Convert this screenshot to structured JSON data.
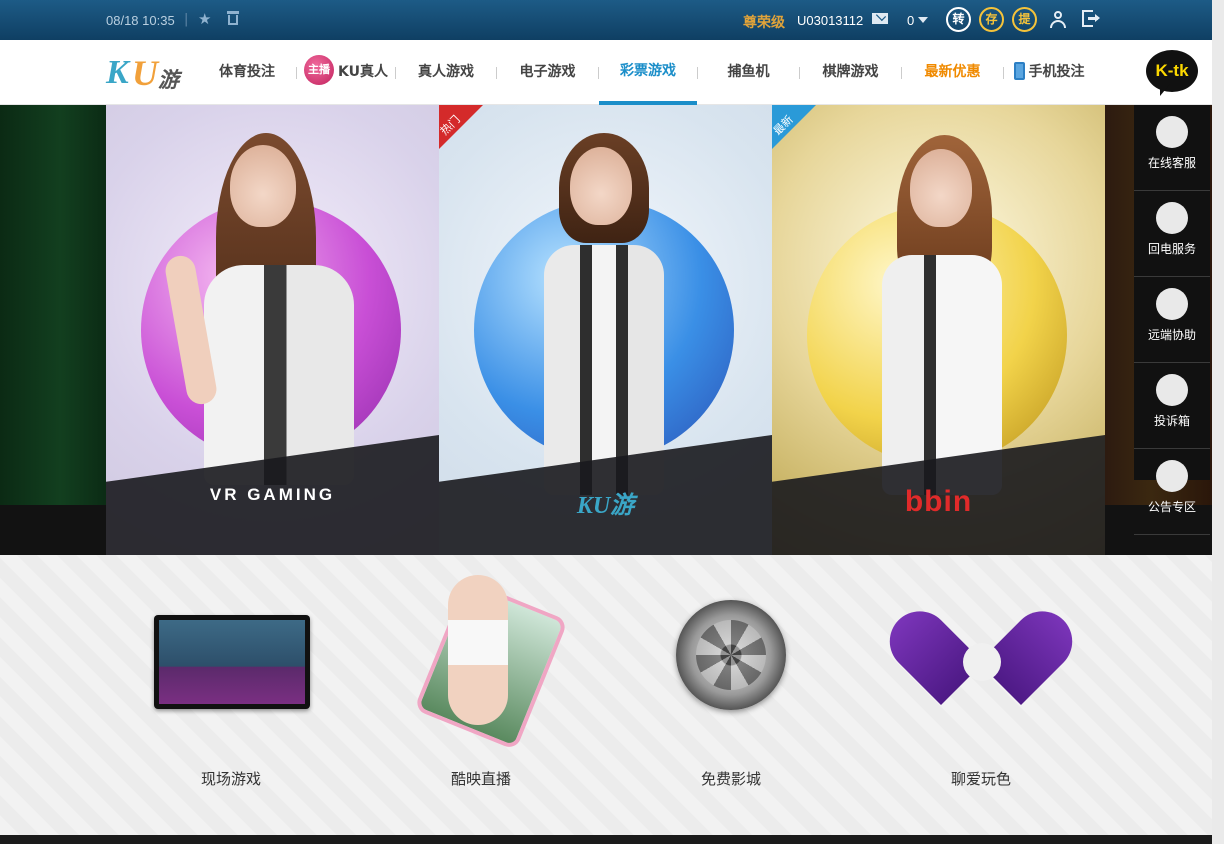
{
  "topbar": {
    "datetime": "08/18 10:35",
    "separator": "|",
    "rank": "尊荣级",
    "user_id": "U03013112",
    "balance": "0",
    "btn_transfer": "转",
    "btn_deposit": "存",
    "btn_withdraw": "提"
  },
  "nav": {
    "items": [
      {
        "label": "体育投注"
      },
      {
        "badge": "主播",
        "label": "KU真人"
      },
      {
        "label": "真人游戏"
      },
      {
        "label": "电子游戏"
      },
      {
        "label": "彩票游戏"
      },
      {
        "label": "捕鱼机"
      },
      {
        "label": "棋牌游戏"
      },
      {
        "label": "最新优惠"
      },
      {
        "label": "手机投注"
      }
    ],
    "active_index": 4,
    "promo_index": 7
  },
  "logo": {
    "k": "K",
    "u": "U",
    "you": "游"
  },
  "ktk": "K-tk",
  "hero": {
    "panels": [
      {
        "brand": "VR GAMING",
        "ribbon": "",
        "theme": "purple"
      },
      {
        "brand": "KU游",
        "ribbon": "热门",
        "theme": "blue"
      },
      {
        "brand": "bbin",
        "ribbon": "最新",
        "theme": "gold"
      }
    ]
  },
  "sidebar": {
    "items": [
      {
        "label": "在线客服",
        "icon": "headset-icon"
      },
      {
        "label": "回电服务",
        "icon": "phone-icon"
      },
      {
        "label": "远端协助",
        "icon": "monitor-icon"
      },
      {
        "label": "投诉箱",
        "icon": "pencil-icon"
      },
      {
        "label": "公告专区",
        "icon": "speaker-icon"
      }
    ]
  },
  "features": [
    {
      "label": "现场游戏"
    },
    {
      "label": "酷映直播"
    },
    {
      "label": "免费影城"
    },
    {
      "label": "聊爱玩色"
    }
  ],
  "colors": {
    "topbar": "#1d5b86",
    "active_nav": "#1b8ec9",
    "promo": "#f08a00",
    "rank": "#e0a33a"
  }
}
